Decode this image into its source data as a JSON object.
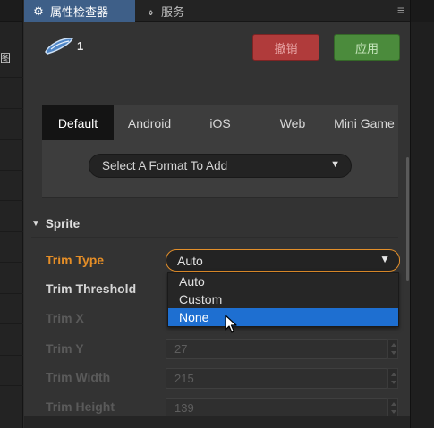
{
  "left_panel": {
    "label": "图"
  },
  "tabs": {
    "active": {
      "icon": "gear-icon",
      "label": "属性检查器"
    },
    "inactive": {
      "icon": "code-brackets-icon",
      "label": "服务"
    },
    "menu_icon": "hamburger-icon"
  },
  "node": {
    "icon": "sprite-node-icon",
    "name": "1"
  },
  "buttons": {
    "revert": "撤销",
    "apply": "应用"
  },
  "platform_tabs": [
    "Default",
    "Android",
    "iOS",
    "Web",
    "Mini Game"
  ],
  "platform_tab_active": "Default",
  "format_select": {
    "label": "Select A Format To Add"
  },
  "sprite_section": {
    "title": "Sprite",
    "properties": {
      "trim_type": "Trim Type",
      "trim_threshold": "Trim Threshold",
      "trim_x": "Trim X",
      "trim_y": "Trim Y",
      "trim_width": "Trim Width",
      "trim_height": "Trim Height"
    },
    "trim_type_value": "Auto",
    "trim_y_value": "27",
    "trim_width_value": "215",
    "trim_height_value": "139"
  },
  "dropdown": {
    "options": [
      "Auto",
      "Custom",
      "None"
    ],
    "highlighted": "None"
  },
  "colors": {
    "accent_tab": "#3e5f88",
    "revert": "#b03b3b",
    "apply": "#4b8b3c",
    "highlight_label": "#e58e27",
    "dropdown_selection": "#1e6fd1"
  }
}
